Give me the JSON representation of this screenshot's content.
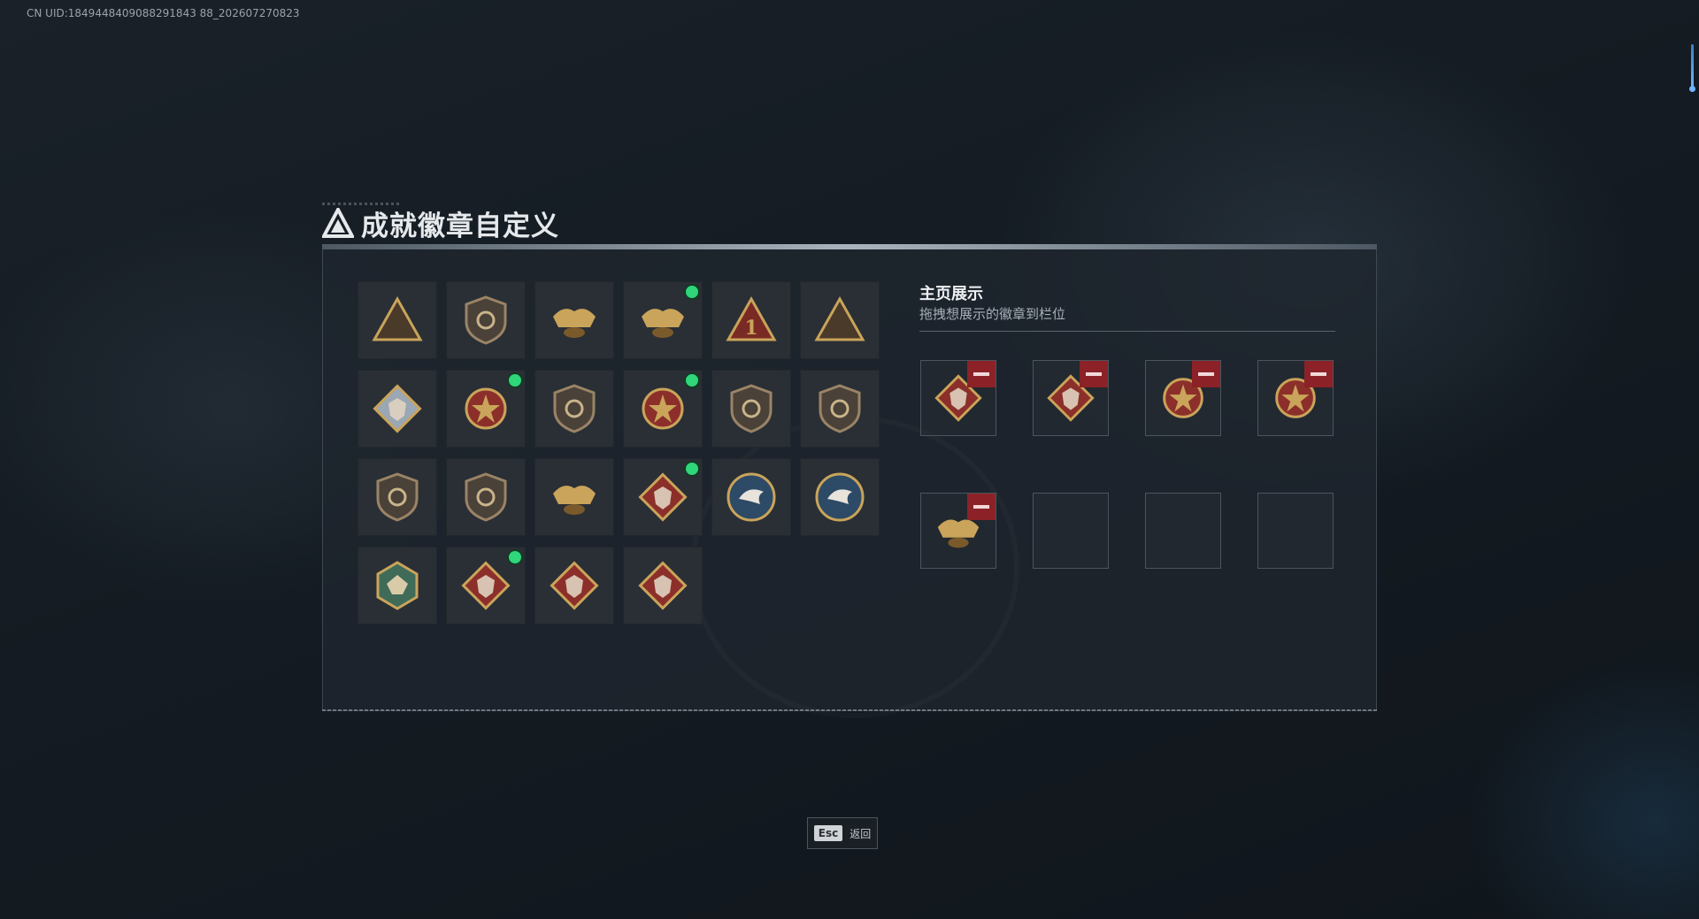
{
  "uid_text": "CN UID:1849448409088291843 88_202607270823",
  "title": "成就徽章自定义",
  "display": {
    "title": "主页展示",
    "subtitle": "拖拽想展示的徽章到栏位"
  },
  "badges": [
    {
      "icon": "shield-triangle-icon",
      "new": false
    },
    {
      "icon": "helicopter-shield-icon",
      "new": false
    },
    {
      "icon": "gold-fortress-icon",
      "new": false
    },
    {
      "icon": "gold-eagle-crest-icon",
      "new": true
    },
    {
      "icon": "number-one-triangle-icon",
      "new": false
    },
    {
      "icon": "soldiers-triangle-icon",
      "new": false
    },
    {
      "icon": "silver-diamond-icon",
      "new": false
    },
    {
      "icon": "red-star-medal-icon",
      "new": true
    },
    {
      "icon": "chevron-shield-icon",
      "new": false
    },
    {
      "icon": "star-shield-medal-icon",
      "new": true
    },
    {
      "icon": "crystal-shield-icon",
      "new": false
    },
    {
      "icon": "skull-crosshair-icon",
      "new": false
    },
    {
      "icon": "rifle-shield-icon",
      "new": false
    },
    {
      "icon": "rifle-shield-gold-icon",
      "new": false
    },
    {
      "icon": "anchor-medal-icon",
      "new": false
    },
    {
      "icon": "wolf-diamond-icon",
      "new": true
    },
    {
      "icon": "eagle-round-blue-icon",
      "new": false
    },
    {
      "icon": "eagle-round-blue-2-icon",
      "new": false
    },
    {
      "icon": "dragon-hexagon-green-icon",
      "new": false
    },
    {
      "icon": "dragon-diamond-icon",
      "new": true
    },
    {
      "icon": "dragon-diamond-2-icon",
      "new": false
    },
    {
      "icon": "runner-diamond-icon",
      "new": false
    }
  ],
  "slots": [
    {
      "icon": "dragon-diamond-icon",
      "filled": true
    },
    {
      "icon": "wolf-diamond-icon",
      "filled": true
    },
    {
      "icon": "star-shield-medal-icon",
      "filled": true
    },
    {
      "icon": "red-star-medal-icon",
      "filled": true
    },
    {
      "icon": "gold-eagle-crest-icon",
      "filled": true
    },
    {
      "icon": "",
      "filled": false
    },
    {
      "icon": "",
      "filled": false
    },
    {
      "icon": "",
      "filled": false
    }
  ],
  "esc": {
    "key": "Esc",
    "label": "返回"
  },
  "colors": {
    "new_dot": "#2fd67a",
    "remove": "#8c2227",
    "gold": "#c9a45a",
    "red": "#8c2f2a",
    "blue": "#2d4a66"
  }
}
